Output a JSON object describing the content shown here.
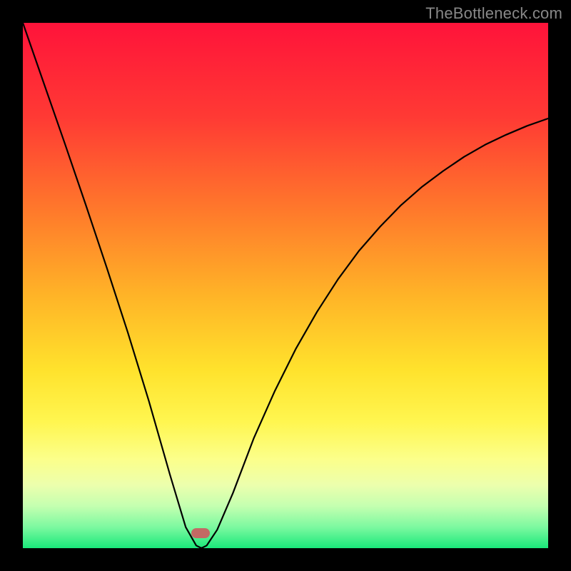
{
  "watermark": "TheBottleneck.com",
  "gradient": {
    "stops": [
      {
        "pct": 0,
        "color": "#ff133a"
      },
      {
        "pct": 18,
        "color": "#ff3a34"
      },
      {
        "pct": 36,
        "color": "#ff7a2b"
      },
      {
        "pct": 52,
        "color": "#ffb427"
      },
      {
        "pct": 66,
        "color": "#ffe22c"
      },
      {
        "pct": 76,
        "color": "#fff650"
      },
      {
        "pct": 83,
        "color": "#fcff8a"
      },
      {
        "pct": 88,
        "color": "#ecffad"
      },
      {
        "pct": 92,
        "color": "#c4ffb0"
      },
      {
        "pct": 96,
        "color": "#7cf9a0"
      },
      {
        "pct": 100,
        "color": "#1ae87a"
      }
    ]
  },
  "marker": {
    "x_pct": 33.8,
    "y_pct": 97.2
  },
  "chart_data": {
    "type": "line",
    "title": "",
    "xlabel": "",
    "ylabel": "",
    "ylim": [
      0,
      100
    ],
    "x": [
      0,
      4,
      8,
      12,
      16,
      20,
      24,
      28,
      31,
      33,
      34,
      35,
      37,
      40,
      44,
      48,
      52,
      56,
      60,
      64,
      68,
      72,
      76,
      80,
      84,
      88,
      92,
      96,
      100
    ],
    "values": [
      100,
      88.5,
      77,
      65.3,
      53.3,
      41,
      28,
      14,
      4,
      0.5,
      0,
      0.5,
      3.5,
      10.5,
      21,
      30,
      38,
      45,
      51.2,
      56.6,
      61.2,
      65.3,
      68.8,
      71.8,
      74.5,
      76.8,
      78.7,
      80.4,
      81.8
    ]
  }
}
